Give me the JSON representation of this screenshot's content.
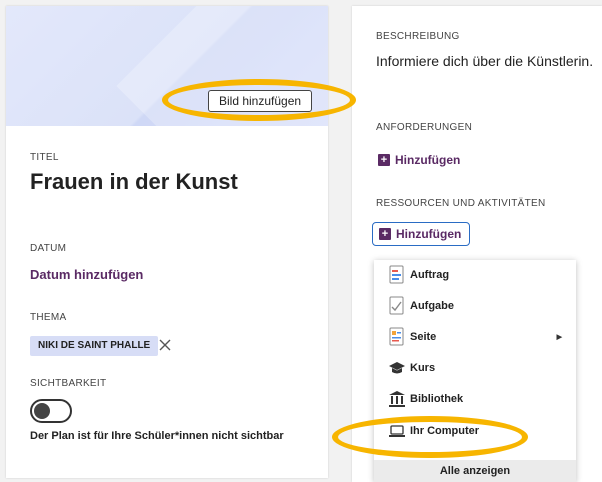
{
  "plan": {
    "add_image_label": "Bild hinzufügen",
    "title_label": "TITEL",
    "title_value": "Frauen in der Kunst",
    "date_label": "DATUM",
    "date_action": "Datum hinzufügen",
    "topic_label": "THEMA",
    "topic_chip": "NIKI DE SAINT PHALLE",
    "visibility_label": "SICHTBARKEIT",
    "visibility_note": "Der Plan ist für Ihre Schüler*innen nicht sichtbar",
    "visibility_on": false
  },
  "details": {
    "description_label": "BESCHREIBUNG",
    "description_value": "Informiere dich über die Künstlerin.",
    "requirements_label": "ANFORDERUNGEN",
    "requirements_add": "Hinzufügen",
    "resources_label": "RESSOURCEN UND AKTIVITÄTEN",
    "resources_add": "Hinzufügen"
  },
  "dropdown": {
    "items": [
      {
        "label": "Auftrag",
        "icon": "assignment-icon"
      },
      {
        "label": "Aufgabe",
        "icon": "task-icon"
      },
      {
        "label": "Seite",
        "icon": "page-icon",
        "has_submenu": true
      },
      {
        "label": "Kurs",
        "icon": "course-icon"
      },
      {
        "label": "Bibliothek",
        "icon": "library-icon"
      },
      {
        "label": "Ihr Computer",
        "icon": "laptop-icon"
      }
    ],
    "show_all": "Alle anzeigen"
  },
  "colors": {
    "accent_purple": "#5a2a64",
    "chip_bg": "#d7ddf6",
    "cover_bg": "#dbe2f8",
    "focus_blue": "#2a6cc4",
    "highlight_yellow": "#f7b500"
  }
}
